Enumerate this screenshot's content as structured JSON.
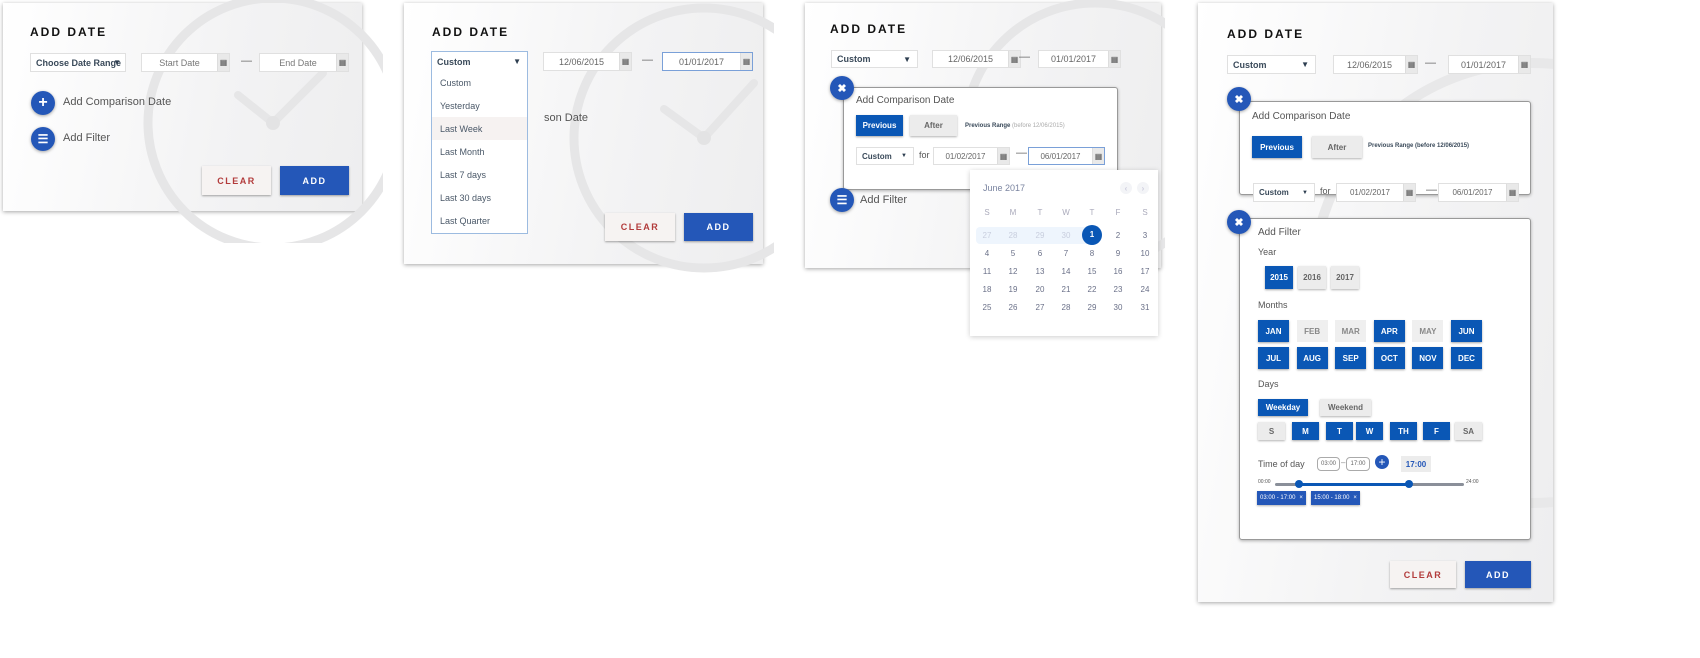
{
  "accent": "#2457b8",
  "panel1": {
    "title": "ADD DATE",
    "range_select": "Choose Date Range",
    "start_placeholder": "Start Date",
    "end_placeholder": "End Date",
    "add_comparison": "Add Comparison Date",
    "add_filter": "Add Filter",
    "clear": "CLEAR",
    "add": "ADD"
  },
  "panel2": {
    "title": "ADD DATE",
    "range_select": "Custom",
    "start": "12/06/2015",
    "end": "01/01/2017",
    "hidden_text": "son Date",
    "options": [
      "Custom",
      "Yesterday",
      "Last Week",
      "Last Month",
      "Last 7 days",
      "Last 30 days",
      "Last Quarter"
    ],
    "highlighted": "Last Week",
    "clear": "CLEAR",
    "add": "ADD"
  },
  "panel3": {
    "title": "ADD DATE",
    "range_select": "Custom",
    "start": "12/06/2015",
    "end": "01/01/2017",
    "comparison": {
      "title": "Add Comparison Date",
      "previous": "Previous",
      "after": "After",
      "range_label": "Previous Range",
      "range_note": "(before 12/06/2015)",
      "select": "Custom",
      "for": "for",
      "start": "01/02/2017",
      "end": "06/01/2017"
    },
    "add_filter": "Add Filter",
    "calendar": {
      "month": "June 2017",
      "weekdays": [
        "S",
        "M",
        "T",
        "W",
        "T",
        "F",
        "S"
      ],
      "prev_month_days": [
        "27",
        "28",
        "29",
        "30"
      ],
      "selected": "1",
      "days": [
        "1",
        "2",
        "3",
        "4",
        "5",
        "6",
        "7",
        "8",
        "9",
        "10",
        "11",
        "12",
        "13",
        "14",
        "15",
        "16",
        "17",
        "18",
        "19",
        "20",
        "21",
        "22",
        "23",
        "24",
        "25",
        "26",
        "27",
        "28",
        "29",
        "30",
        "31"
      ]
    }
  },
  "panel4": {
    "title": "ADD DATE",
    "range_select": "Custom",
    "start": "12/06/2015",
    "end": "01/01/2017",
    "comparison": {
      "title": "Add Comparison Date",
      "previous": "Previous",
      "after": "After",
      "range_label": "Previous Range (before 12/06/2015)",
      "select": "Custom",
      "for": "for",
      "start": "01/02/2017",
      "end": "06/01/2017"
    },
    "filter": {
      "title": "Add Filter",
      "year_label": "Year",
      "years": [
        {
          "label": "2015",
          "on": true
        },
        {
          "label": "2016",
          "on": false
        },
        {
          "label": "2017",
          "on": false
        }
      ],
      "months_label": "Months",
      "months": [
        {
          "label": "JAN",
          "on": true
        },
        {
          "label": "FEB",
          "on": false
        },
        {
          "label": "MAR",
          "on": false
        },
        {
          "label": "APR",
          "on": true
        },
        {
          "label": "MAY",
          "on": false
        },
        {
          "label": "JUN",
          "on": true
        },
        {
          "label": "JUL",
          "on": true
        },
        {
          "label": "AUG",
          "on": true
        },
        {
          "label": "SEP",
          "on": true
        },
        {
          "label": "OCT",
          "on": true
        },
        {
          "label": "NOV",
          "on": true
        },
        {
          "label": "DEC",
          "on": true
        }
      ],
      "days_label": "Days",
      "weekday": "Weekday",
      "weekend": "Weekend",
      "days": [
        {
          "label": "S",
          "on": false
        },
        {
          "label": "M",
          "on": true
        },
        {
          "label": "T",
          "on": true
        },
        {
          "label": "W",
          "on": true
        },
        {
          "label": "TH",
          "on": true
        },
        {
          "label": "F",
          "on": true
        },
        {
          "label": "SA",
          "on": false
        }
      ],
      "time_label": "Time of day",
      "time_from": "03:00",
      "time_to": "17:00",
      "tooltip": "17:00",
      "slider_min": "00:00",
      "slider_max": "24:00",
      "slider_range": [
        3,
        17
      ],
      "chips": [
        "03:00 - 17:00",
        "15:00 - 18:00"
      ]
    },
    "clear": "CLEAR",
    "add": "ADD"
  }
}
